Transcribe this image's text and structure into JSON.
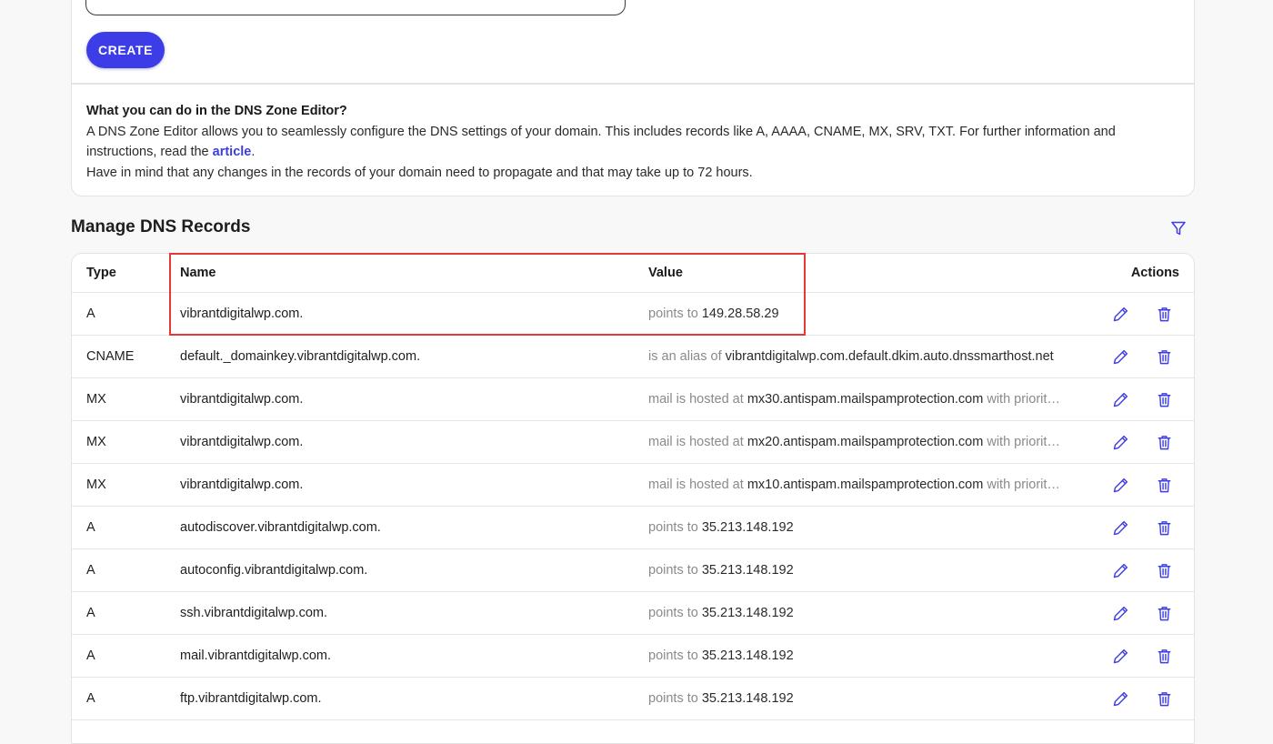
{
  "create_button": {
    "label": "CREATE"
  },
  "info": {
    "title": "What you can do in the DNS Zone Editor?",
    "line1_before_link": "A DNS Zone Editor allows you to seamlessly configure the DNS settings of your domain. This includes records like A, AAAA, CNAME, MX, SRV, TXT. For further information and instructions, read the ",
    "link_text": "article",
    "line1_after_link": ".",
    "line2": "Have in mind that any changes in the records of your domain need to propagate and that may take up to 72 hours."
  },
  "section": {
    "title": "Manage DNS Records",
    "filter_icon": "filter-icon"
  },
  "table": {
    "headers": {
      "type": "Type",
      "name": "Name",
      "value": "Value",
      "actions": "Actions"
    },
    "rows": [
      {
        "type": "A",
        "name": "vibrantdigitalwp.com.",
        "prefix": "points to",
        "value": "149.28.58.29",
        "suffix": ""
      },
      {
        "type": "CNAME",
        "name": "default._domainkey.vibrantdigitalwp.com.",
        "prefix": "is an alias of",
        "value": "vibrantdigitalwp.com.default.dkim.auto.dnssmarthost.net",
        "suffix": ""
      },
      {
        "type": "MX",
        "name": "vibrantdigitalwp.com.",
        "prefix": "mail is hosted at",
        "value": "mx30.antispam.mailspamprotection.com",
        "suffix": "with priorit…"
      },
      {
        "type": "MX",
        "name": "vibrantdigitalwp.com.",
        "prefix": "mail is hosted at",
        "value": "mx20.antispam.mailspamprotection.com",
        "suffix": "with priorit…"
      },
      {
        "type": "MX",
        "name": "vibrantdigitalwp.com.",
        "prefix": "mail is hosted at",
        "value": "mx10.antispam.mailspamprotection.com",
        "suffix": "with priorit…"
      },
      {
        "type": "A",
        "name": "autodiscover.vibrantdigitalwp.com.",
        "prefix": "points to",
        "value": "35.213.148.192",
        "suffix": ""
      },
      {
        "type": "A",
        "name": "autoconfig.vibrantdigitalwp.com.",
        "prefix": "points to",
        "value": "35.213.148.192",
        "suffix": ""
      },
      {
        "type": "A",
        "name": "ssh.vibrantdigitalwp.com.",
        "prefix": "points to",
        "value": "35.213.148.192",
        "suffix": ""
      },
      {
        "type": "A",
        "name": "mail.vibrantdigitalwp.com.",
        "prefix": "points to",
        "value": "35.213.148.192",
        "suffix": ""
      },
      {
        "type": "A",
        "name": "ftp.vibrantdigitalwp.com.",
        "prefix": "points to",
        "value": "35.213.148.192",
        "suffix": ""
      }
    ],
    "row_icons": {
      "edit": "pencil-icon",
      "delete": "trash-icon"
    }
  },
  "colors": {
    "accent": "#3d3de8",
    "highlight_border": "#e53935",
    "muted_text": "#8a8a8a",
    "page_background": "#f8f8f8"
  }
}
